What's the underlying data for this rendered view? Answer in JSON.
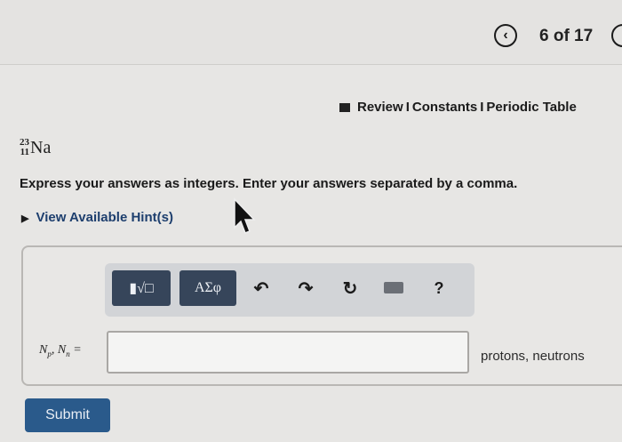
{
  "nav": {
    "prev_icon": "chevron-left-icon",
    "position": "6 of 17"
  },
  "links": {
    "review": "Review",
    "separator": "I",
    "constants": "Constants",
    "periodic_table": "Periodic Table"
  },
  "nuclide": {
    "mass_number": "23",
    "atomic_number": "11",
    "symbol": "Na"
  },
  "instruction": "Express your answers as integers. Enter your answers separated by a comma.",
  "hints": {
    "label": "View Available Hint(s)"
  },
  "toolbar": {
    "templates_label": "▮√□",
    "symbols_label": "AΣφ",
    "undo_icon": "↶",
    "redo_icon": "↷",
    "reset_icon": "↻",
    "help_label": "?"
  },
  "answer": {
    "var_n": "N",
    "sub_p": "p",
    "sub_n": "n",
    "separator": ",",
    "equals": "=",
    "value": "",
    "units": "protons, neutrons"
  },
  "submit_label": "Submit"
}
